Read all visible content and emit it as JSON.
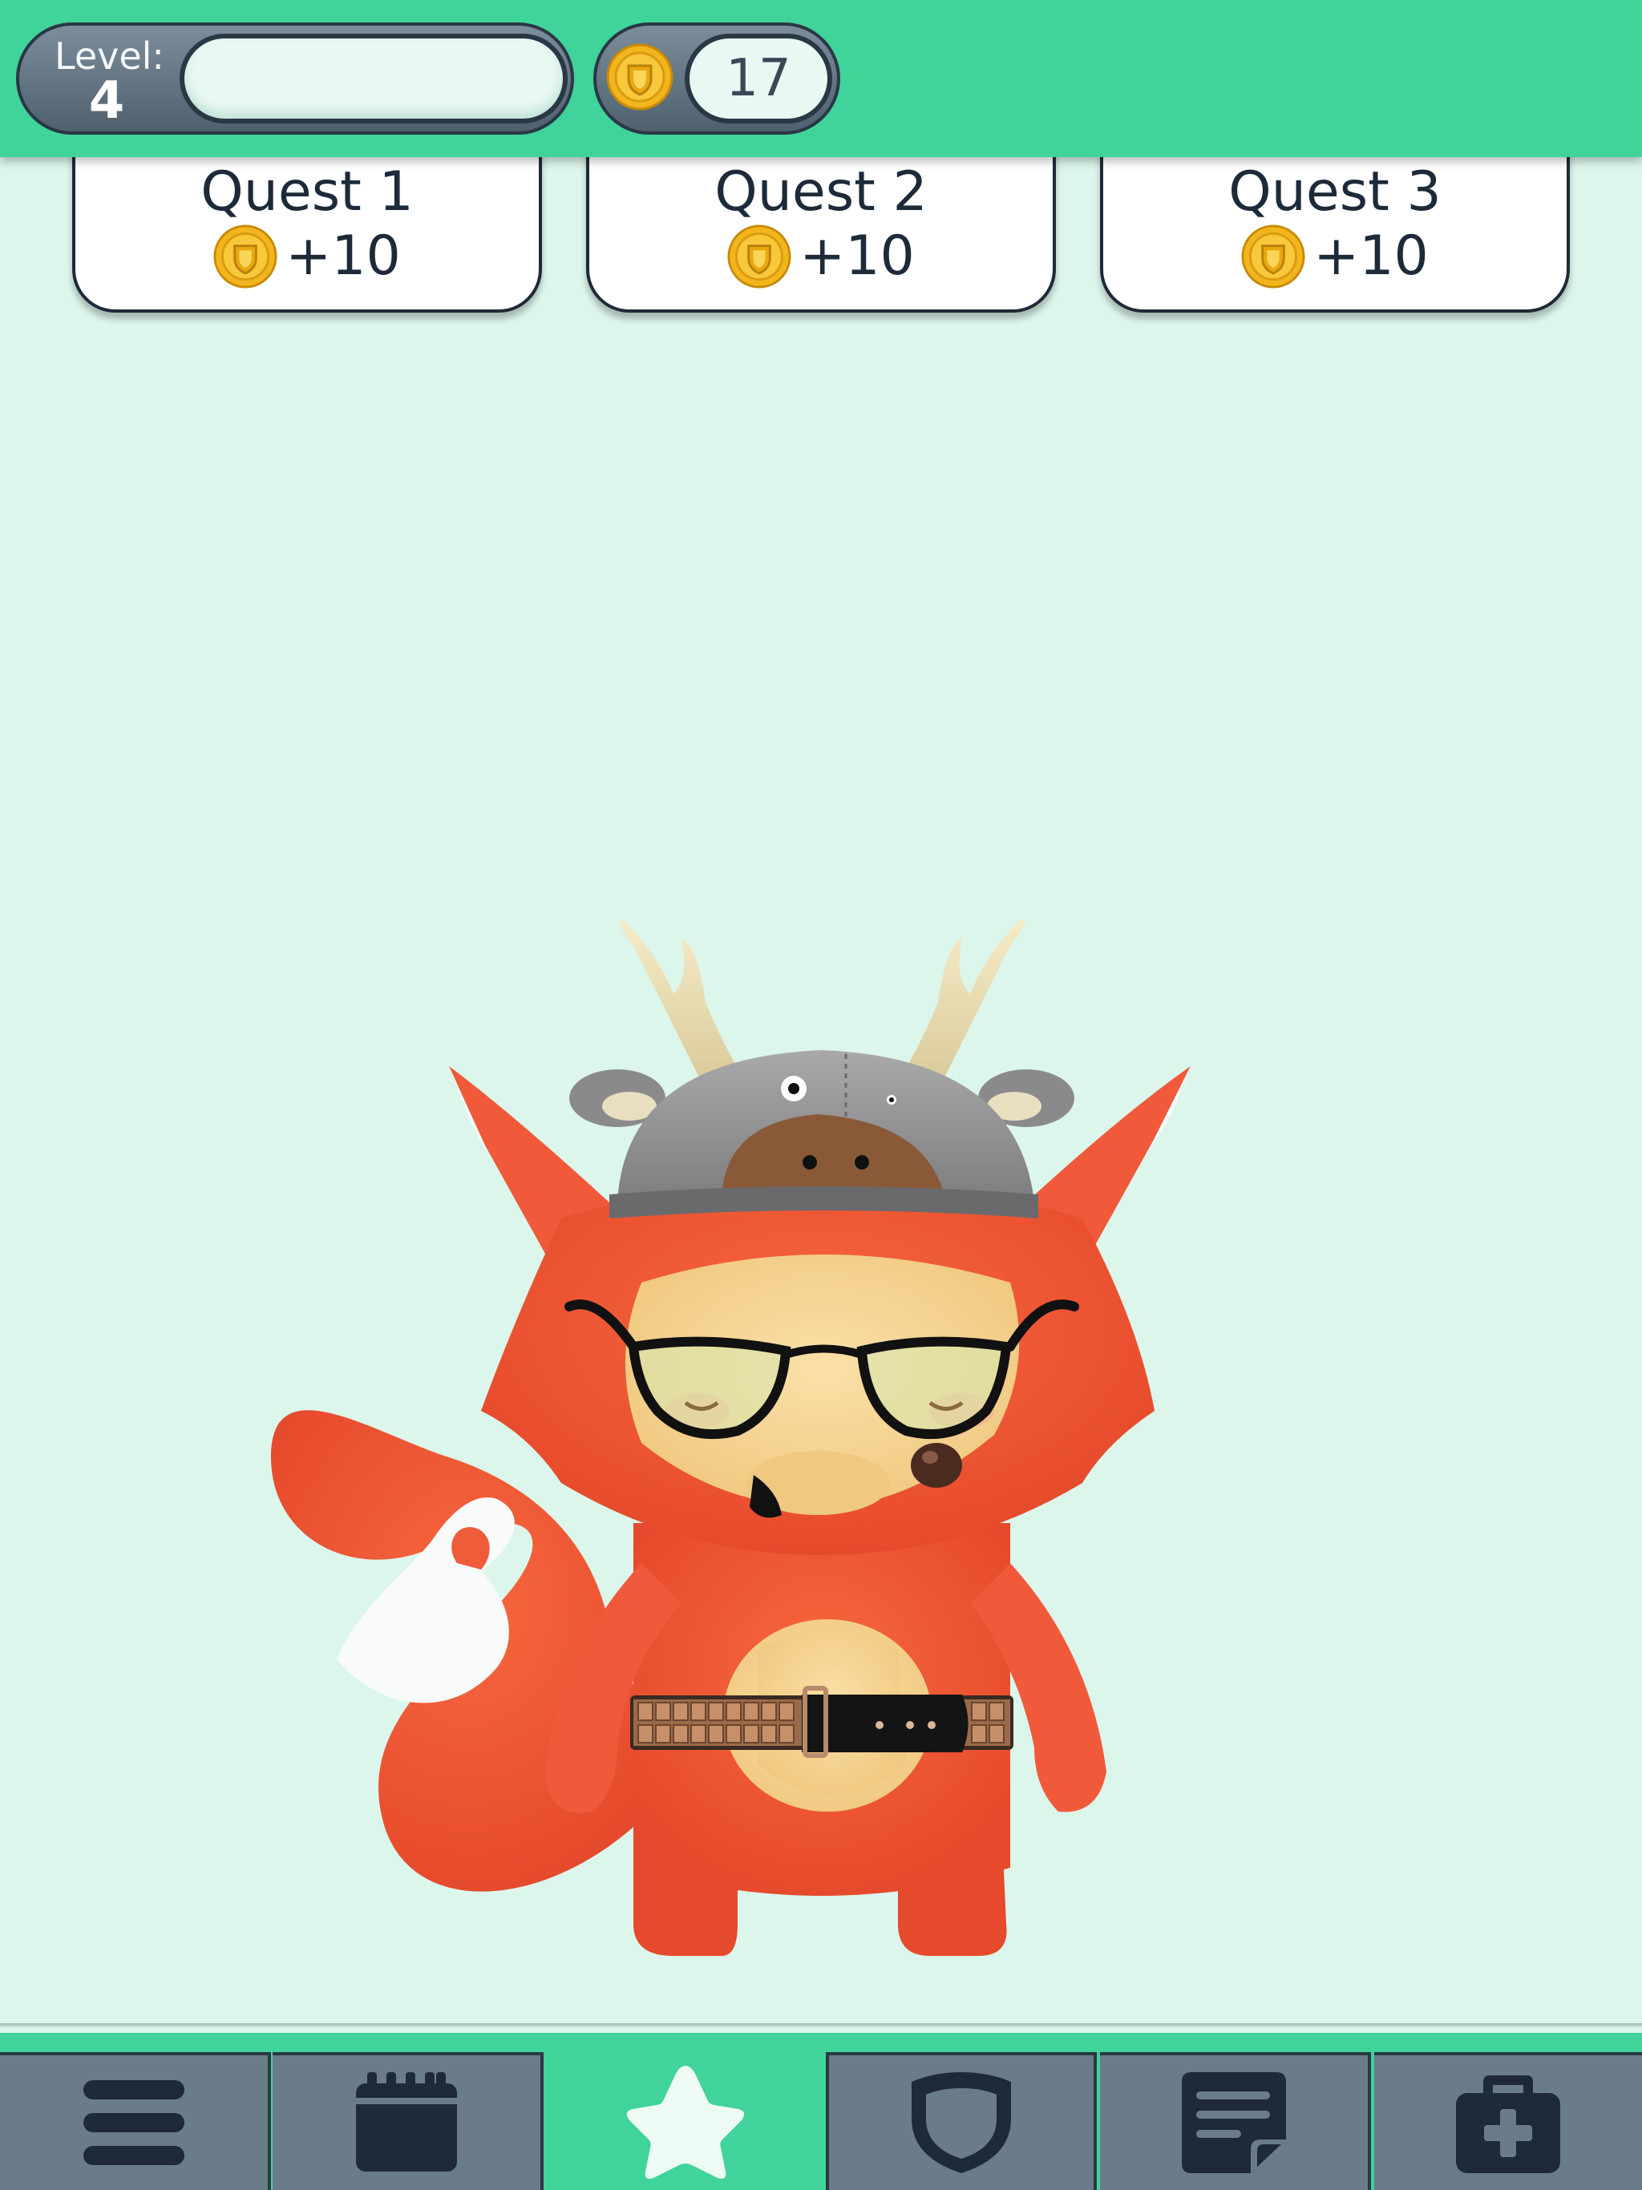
{
  "header": {
    "level_label": "Level:",
    "level_value": "4",
    "xp_progress": 0,
    "coins": "17"
  },
  "quests": [
    {
      "title": "Quest 1",
      "reward": "+10",
      "icon": "coin-icon"
    },
    {
      "title": "Quest 2",
      "reward": "+10",
      "icon": "coin-icon"
    },
    {
      "title": "Quest 3",
      "reward": "+10",
      "icon": "coin-icon"
    }
  ],
  "character": {
    "species": "fox",
    "accessories": [
      "moose-hat",
      "glasses",
      "studded-belt"
    ]
  },
  "bottom_nav": {
    "items": [
      {
        "icon": "menu-icon",
        "active": false
      },
      {
        "icon": "calendar-icon",
        "active": false
      },
      {
        "icon": "star-icon",
        "active": true
      },
      {
        "icon": "shield-icon",
        "active": false
      },
      {
        "icon": "notes-icon",
        "active": false
      },
      {
        "icon": "medkit-icon",
        "active": false
      }
    ]
  },
  "colors": {
    "accent": "#40d39a",
    "background": "#dcf6ec",
    "nav_inactive": "#6b7c89",
    "fox_orange": "#f05a3a",
    "coin_gold": "#f3b51d"
  }
}
